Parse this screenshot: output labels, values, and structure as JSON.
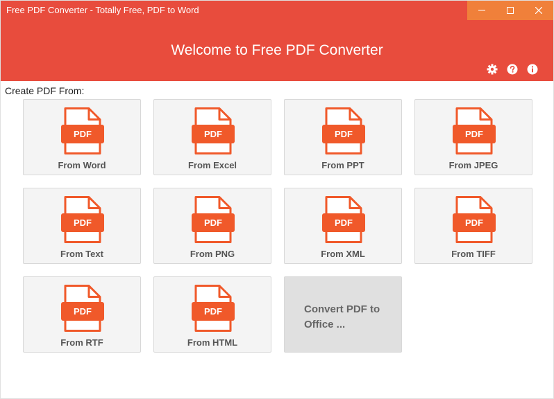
{
  "window": {
    "title": "Free PDF Converter - Totally Free, PDF to Word",
    "controls": [
      "minimize-icon",
      "maximize-icon",
      "close-icon"
    ]
  },
  "header": {
    "welcome": "Welcome to Free PDF Converter",
    "icons": [
      "gear-icon",
      "help-icon",
      "info-icon"
    ]
  },
  "section_label": "Create PDF From:",
  "pdf_badge": "PDF",
  "tiles": [
    {
      "label": "From Word"
    },
    {
      "label": "From Excel"
    },
    {
      "label": "From PPT"
    },
    {
      "label": "From JPEG"
    },
    {
      "label": "From Text"
    },
    {
      "label": "From PNG"
    },
    {
      "label": "From XML"
    },
    {
      "label": "From TIFF"
    },
    {
      "label": "From RTF"
    },
    {
      "label": "From HTML"
    }
  ],
  "office_tile": {
    "label_line1": "Convert PDF to",
    "label_line2": "Office ..."
  },
  "colors": {
    "accent": "#e84c3d",
    "controls_bg": "#f0803a",
    "doc_icon": "#f0592a",
    "tile_bg": "#f4f4f4",
    "office_tile_bg": "#e0e0e0"
  }
}
